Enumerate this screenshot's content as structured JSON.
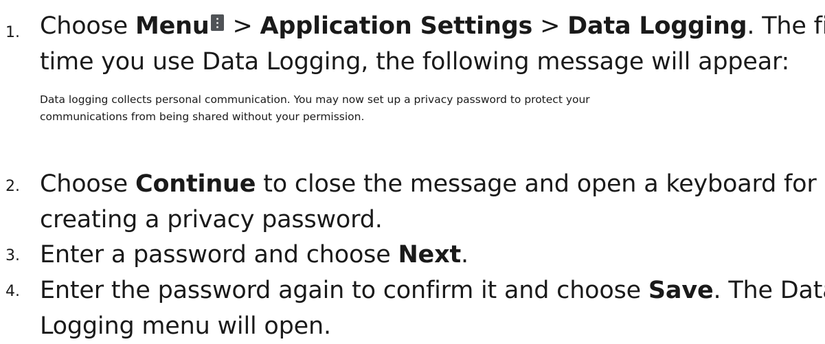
{
  "steps": [
    {
      "number": "1.",
      "lines": [
        {
          "parts": [
            {
              "text": "Choose "
            },
            {
              "text": "Menu",
              "bold": true
            },
            {
              "icon": "menu-icon"
            },
            {
              "text": " > "
            },
            {
              "text": "Application Settings",
              "bold": true
            },
            {
              "text": " > "
            },
            {
              "text": "Data Logging",
              "bold": true
            },
            {
              "text": ". The first"
            }
          ]
        },
        {
          "parts": [
            {
              "text": "time you use Data Logging, the following message will appear:"
            }
          ]
        }
      ]
    },
    {
      "number": "2.",
      "lines": [
        {
          "parts": [
            {
              "text": "Choose "
            },
            {
              "text": "Continue",
              "bold": true
            },
            {
              "text": " to close the message and open a keyboard for"
            }
          ]
        },
        {
          "parts": [
            {
              "text": "creating a privacy password."
            }
          ]
        }
      ]
    },
    {
      "number": "3.",
      "lines": [
        {
          "parts": [
            {
              "text": "Enter a password and choose "
            },
            {
              "text": "Next",
              "bold": true
            },
            {
              "text": "."
            }
          ]
        }
      ]
    },
    {
      "number": "4.",
      "lines": [
        {
          "parts": [
            {
              "text": "Enter the password again to confirm it and choose "
            },
            {
              "text": "Save",
              "bold": true
            },
            {
              "text": ". The Data"
            }
          ]
        },
        {
          "parts": [
            {
              "text": "Logging menu will open."
            }
          ]
        }
      ]
    }
  ],
  "message": {
    "line1": "Data logging collects personal communication. You may now set up a privacy password to protect your",
    "line2": "communications from being shared without your permission."
  },
  "colors": {
    "text": "#1a1a1a",
    "menu_icon_bg": "#505357"
  }
}
